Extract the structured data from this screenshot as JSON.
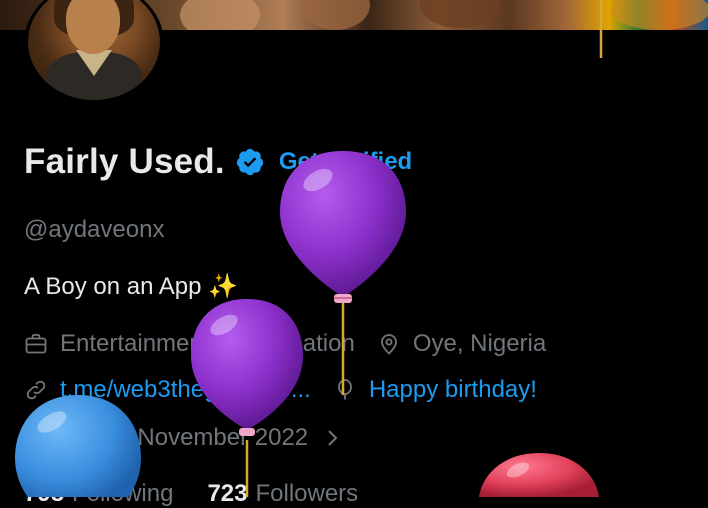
{
  "profile": {
    "name": "Fairly Used.",
    "get_verified_label": "Get Verified",
    "handle": "@aydaveonx",
    "bio": "A Boy on an App ✨",
    "category": "Entertainment & Recreation",
    "location": "Oye, Nigeria",
    "link": "t.me/web3thegoodthe...",
    "birthday": "Happy birthday!",
    "joined": "Joined November 2022",
    "following_count": "798",
    "following_label": "Following",
    "followers_count": "723",
    "followers_label": "Followers"
  },
  "icons": {
    "verified": "verified-badge-icon",
    "category": "briefcase-icon",
    "location": "location-pin-icon",
    "link": "link-icon",
    "birthday": "balloon-icon",
    "joined": "calendar-icon",
    "joined_more": "chevron-right-icon"
  },
  "colors": {
    "background": "#000000",
    "text_primary": "#e7e9ea",
    "text_secondary": "#71767b",
    "accent": "#1d9bf0",
    "balloon_purple": "#8b2fc9",
    "balloon_blue": "#3b8fe0",
    "balloon_red": "#e0405a"
  }
}
